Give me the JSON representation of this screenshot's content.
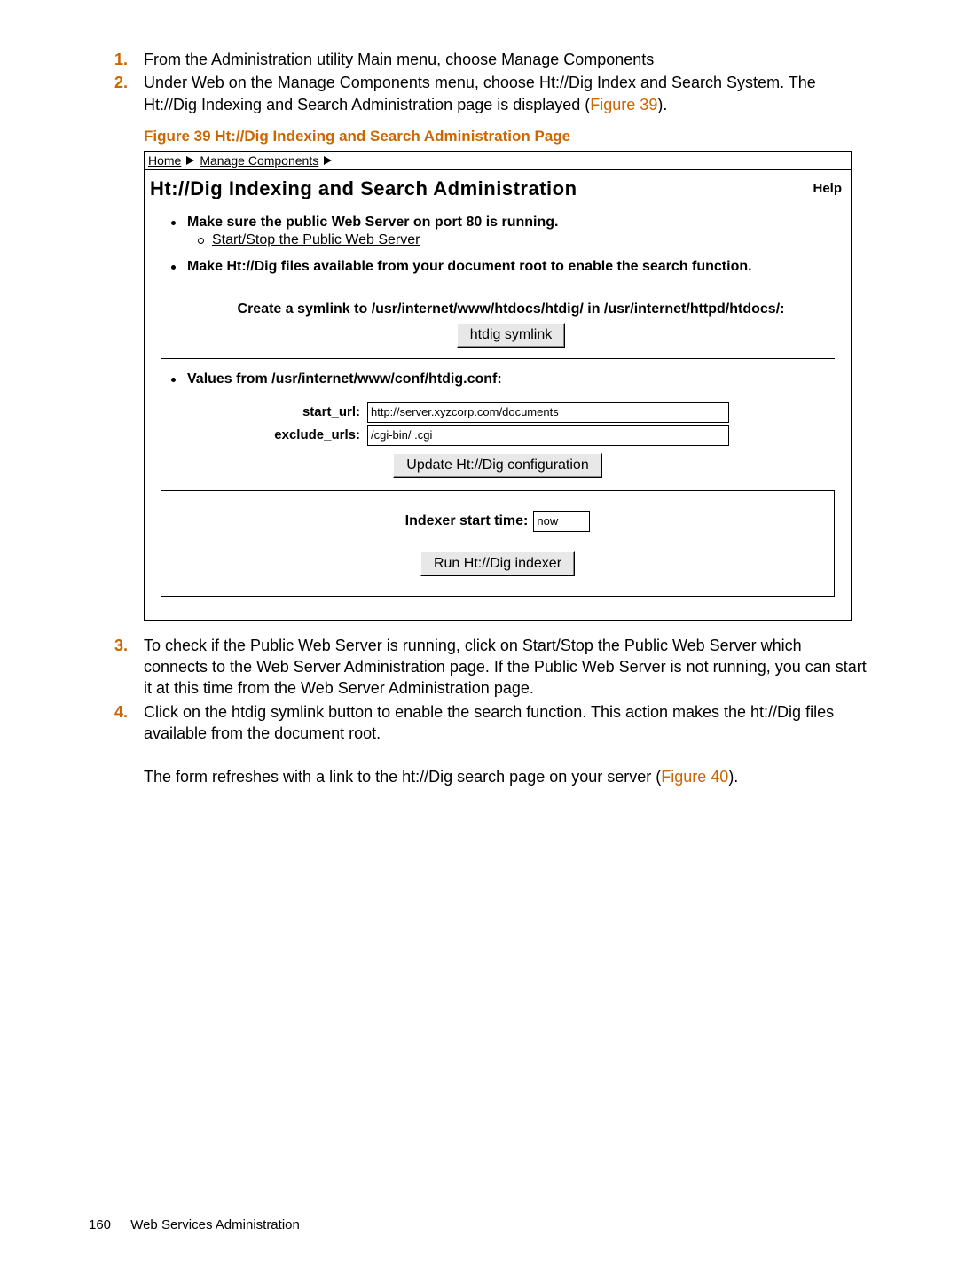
{
  "steps_top": [
    {
      "num": "1.",
      "text": "From the Administration utility Main menu, choose Manage Components"
    },
    {
      "num": "2.",
      "text_a": "Under Web on the Manage Components menu, choose Ht://Dig Index and Search System. The Ht://Dig Indexing and Search Administration page is displayed (",
      "link": "Figure 39",
      "text_b": ")."
    }
  ],
  "figure_caption": "Figure 39 Ht://Dig Indexing and Search Administration Page",
  "breadcrumbs": {
    "home": "Home",
    "manage": "Manage Components"
  },
  "admin": {
    "title": "Ht://Dig Indexing and Search Administration",
    "help": "Help",
    "b1": "Make sure the public Web Server on port 80 is running.",
    "b1_sub": "Start/Stop the Public Web Server",
    "b2": "Make Ht://Dig files available from your document root to enable the search function.",
    "symlink_text": "Create a symlink to /usr/internet/www/htdocs/htdig/ in /usr/internet/httpd/htdocs/:",
    "symlink_btn": "htdig symlink",
    "b3": "Values from /usr/internet/www/conf/htdig.conf:",
    "start_url_label": "start_url:",
    "start_url_value": "http://server.xyzcorp.com/documents",
    "exclude_label": "exclude_urls:",
    "exclude_value": "/cgi-bin/ .cgi",
    "update_btn": "Update Ht://Dig configuration",
    "indexer_label": "Indexer start time:",
    "indexer_value": "now",
    "run_btn": "Run Ht://Dig indexer"
  },
  "steps_bottom": [
    {
      "num": "3.",
      "text": "To check if the Public Web Server is running, click on Start/Stop the Public Web Server which connects to the Web Server Administration page. If the Public Web Server is not running, you can start it at this time from the Web Server Administration page."
    },
    {
      "num": "4.",
      "text_a": "Click on the htdig symlink button to enable the search function. This action makes the ht://Dig files available from the document root.",
      "text_b1": "The form refreshes with a link to the ht://Dig search page on your server (",
      "link": "Figure 40",
      "text_b2": ")."
    }
  ],
  "footer": {
    "page": "160",
    "section": "Web Services Administration"
  }
}
